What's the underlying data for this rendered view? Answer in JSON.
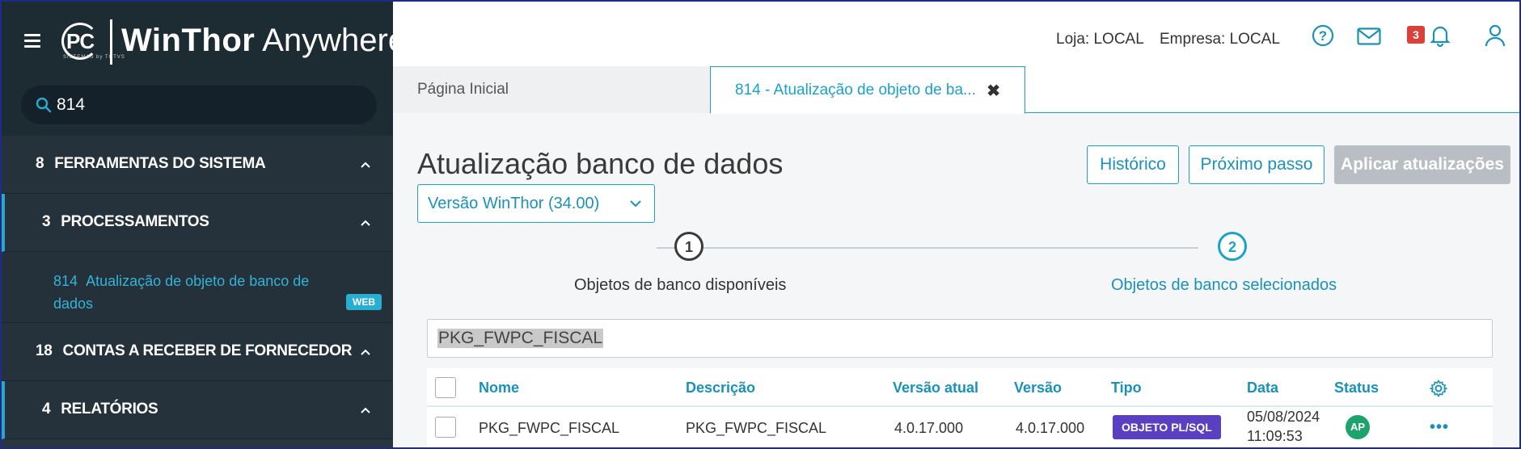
{
  "sidebar": {
    "logo": {
      "mark": "PC",
      "sub": "SISTEMAS by TOTVS"
    },
    "brand": {
      "bold": "WinThor",
      "light": "Anywhere"
    },
    "search": {
      "value": "814"
    },
    "items": [
      {
        "num": "8",
        "label": "FERRAMENTAS DO SISTEMA"
      },
      {
        "num": "3",
        "label": "PROCESSAMENTOS"
      },
      {
        "num": "18",
        "label": "CONTAS A RECEBER DE FORNECEDOR"
      },
      {
        "num": "4",
        "label": "RELATÓRIOS"
      }
    ],
    "subitem": {
      "num": "814",
      "label": "Atualização de objeto de banco de dados",
      "badge": "WEB"
    }
  },
  "topbar": {
    "loja": "Loja: LOCAL",
    "empresa": "Empresa: LOCAL",
    "mail_count": "3",
    "icons": [
      "help-icon",
      "mail-icon",
      "bell-icon",
      "user-icon"
    ]
  },
  "tabs": [
    {
      "label": "Página Inicial"
    },
    {
      "label": "814 - Atualização de objeto de ba...",
      "close": "✖"
    }
  ],
  "main": {
    "title": "Atualização banco de dados",
    "buttons": {
      "historico": "Histórico",
      "proximo": "Próximo passo",
      "aplicar": "Aplicar atualizações"
    },
    "version_select": "Versão WinThor (34.00)",
    "steps": [
      {
        "n": "1",
        "label": "Objetos de banco disponíveis"
      },
      {
        "n": "2",
        "label": "Objetos de banco selecionados"
      }
    ],
    "filter_value": "PKG_FWPC_FISCAL"
  },
  "table": {
    "headers": [
      "Nome",
      "Descrição",
      "Versão atual",
      "Versão",
      "Tipo",
      "Data",
      "Status"
    ],
    "rows": [
      {
        "nome": "PKG_FWPC_FISCAL",
        "descricao": "PKG_FWPC_FISCAL",
        "versao_atual": "4.0.17.000",
        "versao": "4.0.17.000",
        "tipo": "OBJETO PL/SQL",
        "data_line1": "05/08/2024",
        "data_line2": "11:09:53",
        "status": "AP"
      }
    ]
  },
  "colors": {
    "accent": "#1aa3c9",
    "sidebar": "#2a363f",
    "badge_purple": "#5a3fc0",
    "status_green": "#1fa36d",
    "mail_badge": "#d9413b"
  }
}
